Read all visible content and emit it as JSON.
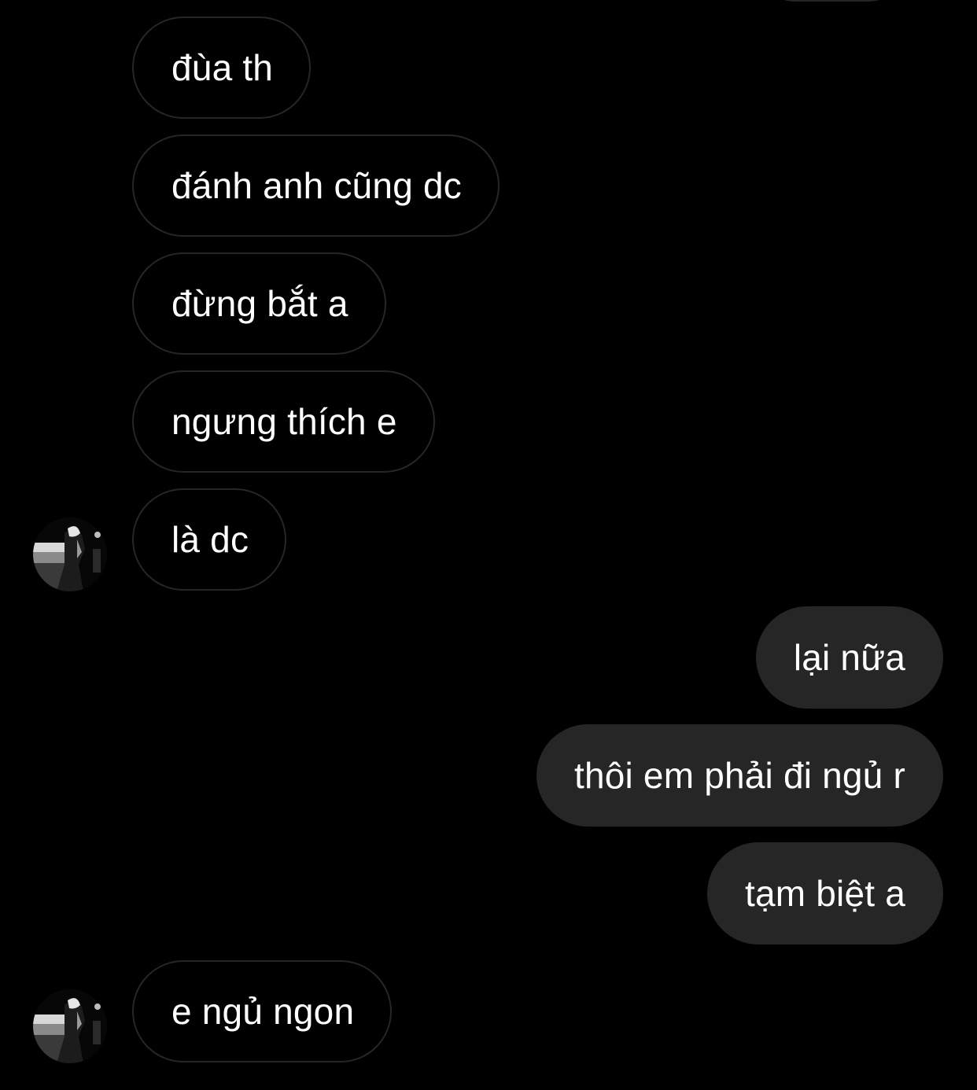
{
  "conversation": {
    "messages": [
      {
        "direction": "incoming",
        "text": "đùa th"
      },
      {
        "direction": "incoming",
        "text": "đánh anh cũng dc"
      },
      {
        "direction": "incoming",
        "text": "đừng bắt a"
      },
      {
        "direction": "incoming",
        "text": "ngưng thích e"
      },
      {
        "direction": "incoming",
        "text": "là dc"
      },
      {
        "direction": "outgoing",
        "text": "lại nữa"
      },
      {
        "direction": "outgoing",
        "text": "thôi em phải đi ngủ r"
      },
      {
        "direction": "outgoing",
        "text": "tạm biệt a"
      },
      {
        "direction": "incoming",
        "text": "e ngủ ngon"
      }
    ]
  },
  "colors": {
    "background": "#000000",
    "outgoing_bubble": "#262626",
    "incoming_border": "#262626",
    "text": "#ffffff"
  },
  "icons": {
    "avatar": "contact-avatar-photo"
  }
}
